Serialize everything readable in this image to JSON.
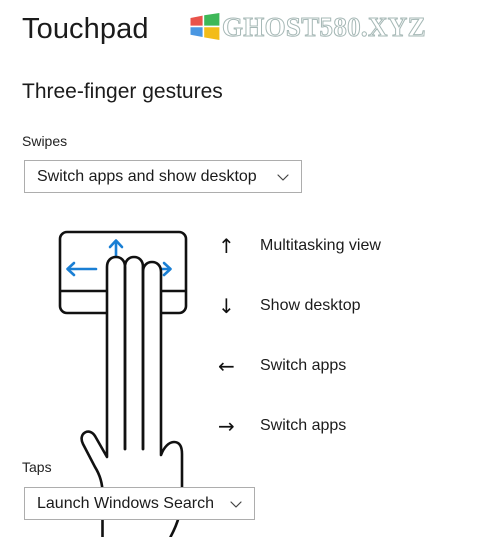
{
  "header": {
    "title": "Touchpad",
    "watermark_text": "GHOST580.XYZ",
    "watermark_logo_name": "windows-logo-icon",
    "watermark_color": "#9fb3b0",
    "logo_colors": {
      "top_left": "#e8453c",
      "top_right": "#2eb34a",
      "bottom_left": "#3b8fe0",
      "bottom_right": "#f2b705"
    }
  },
  "section": {
    "heading": "Three-finger gestures"
  },
  "swipes": {
    "label": "Swipes",
    "selected": "Switch apps and show desktop",
    "chevron_icon": "chevron-down-icon"
  },
  "taps": {
    "label": "Taps",
    "selected": "Launch Windows Search",
    "chevron_icon": "chevron-down-icon"
  },
  "illustration": {
    "name": "three-finger-touchpad-diagram",
    "arrow_color": "#1a7fd4",
    "outline_color": "#111111",
    "arrows": [
      "up",
      "left",
      "right"
    ]
  },
  "legend": {
    "rows": [
      {
        "arrow": "↑",
        "direction": "up",
        "label": "Multitasking view"
      },
      {
        "arrow": "↓",
        "direction": "down",
        "label": "Show desktop"
      },
      {
        "arrow": "←",
        "direction": "left",
        "label": "Switch apps"
      },
      {
        "arrow": "→",
        "direction": "right",
        "label": "Switch apps"
      }
    ]
  }
}
